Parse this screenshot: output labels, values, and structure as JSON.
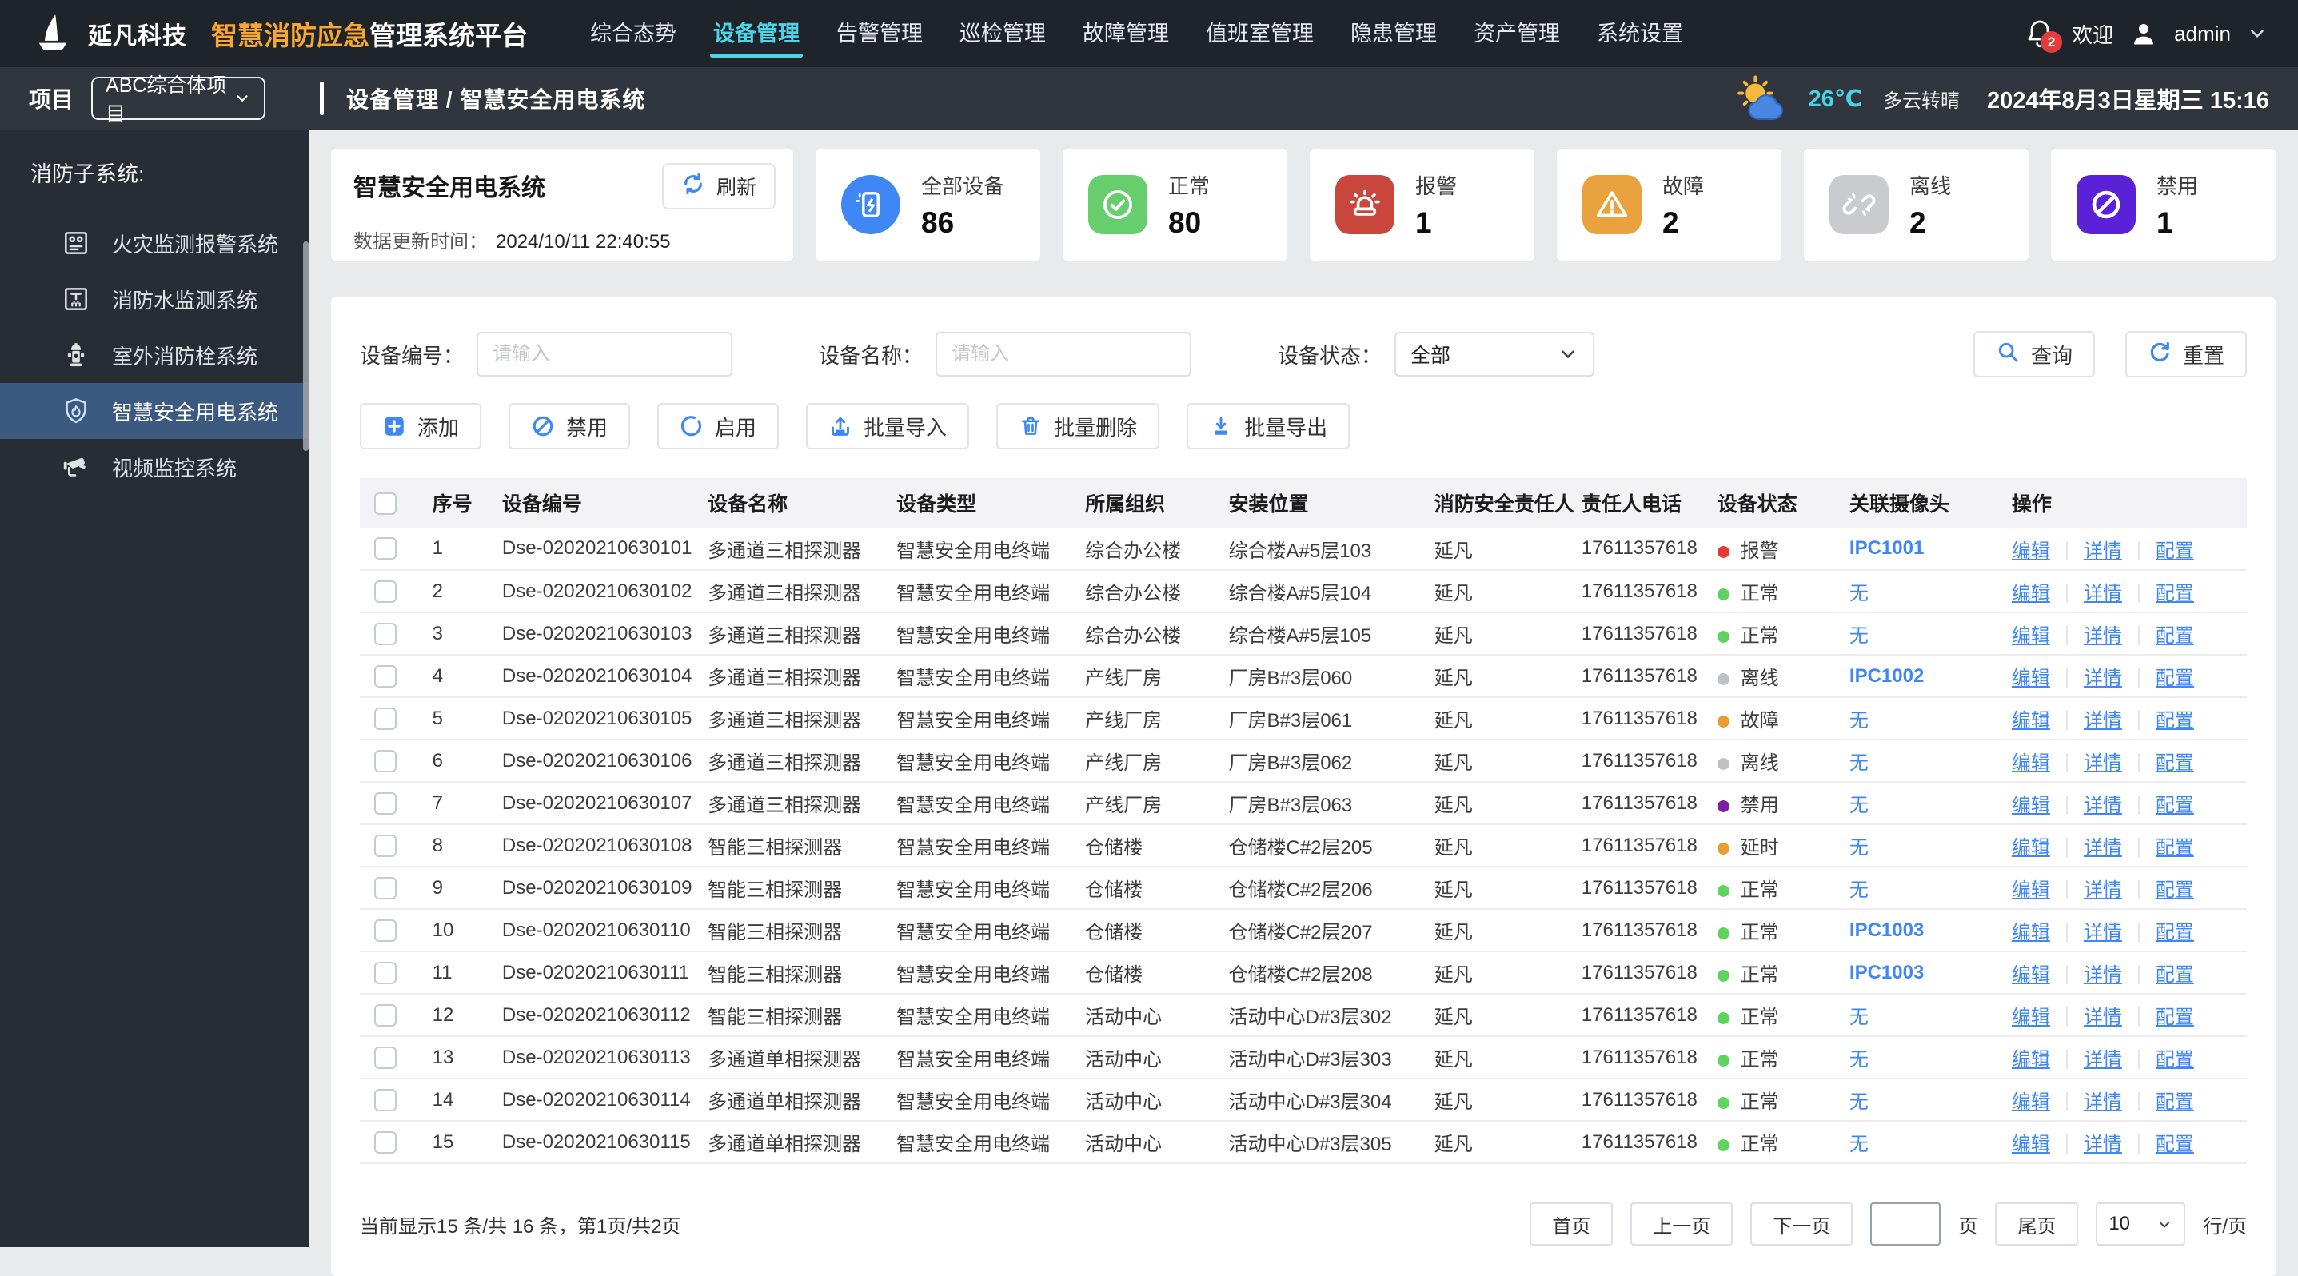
{
  "topbar": {
    "brand": {
      "company": "延凡科技",
      "highlight": "智慧消防应急",
      "suffix": "管理系统平台"
    },
    "nav": [
      {
        "label": "综合态势",
        "active": false
      },
      {
        "label": "设备管理",
        "active": true
      },
      {
        "label": "告警管理",
        "active": false
      },
      {
        "label": "巡检管理",
        "active": false
      },
      {
        "label": "故障管理",
        "active": false
      },
      {
        "label": "值班室管理",
        "active": false
      },
      {
        "label": "隐患管理",
        "active": false
      },
      {
        "label": "资产管理",
        "active": false
      },
      {
        "label": "系统设置",
        "active": false
      }
    ],
    "notification_count": "2",
    "welcome": "欢迎",
    "username": "admin",
    "active_color": "#4ed4e6"
  },
  "subheader": {
    "project_label": "项目",
    "project_value": "ABC综合体项目",
    "breadcrumb": "设备管理 / 智慧安全用电系统",
    "weather_temp": "26℃",
    "weather_condition": "多云转晴",
    "datetime": "2024年8月3日星期三 15:16"
  },
  "sidebar": {
    "group_label": "消防子系统:",
    "items": [
      {
        "label": "火灾监测报警系统",
        "icon": "fire-alarm-panel-icon",
        "active": false
      },
      {
        "label": "消防水监测系统",
        "icon": "water-monitor-icon",
        "active": false
      },
      {
        "label": "室外消防栓系统",
        "icon": "hydrant-icon",
        "active": false
      },
      {
        "label": "智慧安全用电系统",
        "icon": "shield-flame-icon",
        "active": true
      },
      {
        "label": "视频监控系统",
        "icon": "camera-icon",
        "active": false
      }
    ]
  },
  "overview": {
    "title": "智慧安全用电系统",
    "refresh_label": "刷新",
    "updated_label": "数据更新时间：",
    "updated_value": "2024/10/11 22:40:55",
    "stats": [
      {
        "label": "全部设备",
        "value": "86",
        "icon": "device-icon",
        "bg": "#3f87f5",
        "shape": "circle"
      },
      {
        "label": "正常",
        "value": "80",
        "icon": "check-icon",
        "bg": "#67ce6e",
        "shape": "square"
      },
      {
        "label": "报警",
        "value": "1",
        "icon": "alarm-icon",
        "bg": "#c9463d",
        "shape": "square"
      },
      {
        "label": "故障",
        "value": "2",
        "icon": "fault-icon",
        "bg": "#eaa23e",
        "shape": "square"
      },
      {
        "label": "离线",
        "value": "2",
        "icon": "offline-icon",
        "bg": "#c9cbce",
        "shape": "square"
      },
      {
        "label": "禁用",
        "value": "1",
        "icon": "ban-icon",
        "bg": "#5b21d6",
        "shape": "square"
      }
    ]
  },
  "filters": {
    "device_no_label": "设备编号：",
    "device_no_placeholder": "请输入",
    "device_name_label": "设备名称：",
    "device_name_placeholder": "请输入",
    "status_label": "设备状态：",
    "status_value": "全部",
    "search_label": "查询",
    "reset_label": "重置"
  },
  "actions": [
    {
      "label": "添加",
      "icon": "plus-square-icon"
    },
    {
      "label": "禁用",
      "icon": "ban-circle-icon"
    },
    {
      "label": "启用",
      "icon": "enable-circle-icon"
    },
    {
      "label": "批量导入",
      "icon": "import-icon"
    },
    {
      "label": "批量删除",
      "icon": "trash-icon"
    },
    {
      "label": "批量导出",
      "icon": "export-icon"
    }
  ],
  "table": {
    "columns": [
      "",
      "序号",
      "设备编号",
      "设备名称",
      "设备类型",
      "所属组织",
      "安装位置",
      "消防安全责任人",
      "责任人电话",
      "设备状态",
      "关联摄像头",
      "操作"
    ],
    "ops": [
      "编辑",
      "详情",
      "配置"
    ],
    "status_colors": {
      "报警": "#e53935",
      "正常": "#5ed45e",
      "离线": "#bfc1c4",
      "故障": "#eb9c32",
      "禁用": "#7b1fa2",
      "延时": "#eb9c32"
    },
    "link_color": "#3f87f5",
    "rows": [
      {
        "no": "1",
        "code": "Dse-02020210630101",
        "name": "多通道三相探测器",
        "type": "智慧安全用电终端",
        "org": "综合办公楼",
        "location": "综合楼A#5层103",
        "person": "延凡",
        "phone": "17611357618",
        "status": "报警",
        "camera": "IPC1001"
      },
      {
        "no": "2",
        "code": "Dse-02020210630102",
        "name": "多通道三相探测器",
        "type": "智慧安全用电终端",
        "org": "综合办公楼",
        "location": "综合楼A#5层104",
        "person": "延凡",
        "phone": "17611357618",
        "status": "正常",
        "camera": "无"
      },
      {
        "no": "3",
        "code": "Dse-02020210630103",
        "name": "多通道三相探测器",
        "type": "智慧安全用电终端",
        "org": "综合办公楼",
        "location": "综合楼A#5层105",
        "person": "延凡",
        "phone": "17611357618",
        "status": "正常",
        "camera": "无"
      },
      {
        "no": "4",
        "code": "Dse-02020210630104",
        "name": "多通道三相探测器",
        "type": "智慧安全用电终端",
        "org": "产线厂房",
        "location": "厂房B#3层060",
        "person": "延凡",
        "phone": "17611357618",
        "status": "离线",
        "camera": "IPC1002"
      },
      {
        "no": "5",
        "code": "Dse-02020210630105",
        "name": "多通道三相探测器",
        "type": "智慧安全用电终端",
        "org": "产线厂房",
        "location": "厂房B#3层061",
        "person": "延凡",
        "phone": "17611357618",
        "status": "故障",
        "camera": "无"
      },
      {
        "no": "6",
        "code": "Dse-02020210630106",
        "name": "多通道三相探测器",
        "type": "智慧安全用电终端",
        "org": "产线厂房",
        "location": "厂房B#3层062",
        "person": "延凡",
        "phone": "17611357618",
        "status": "离线",
        "camera": "无"
      },
      {
        "no": "7",
        "code": "Dse-02020210630107",
        "name": "多通道三相探测器",
        "type": "智慧安全用电终端",
        "org": "产线厂房",
        "location": "厂房B#3层063",
        "person": "延凡",
        "phone": "17611357618",
        "status": "禁用",
        "camera": "无"
      },
      {
        "no": "8",
        "code": "Dse-02020210630108",
        "name": "智能三相探测器",
        "type": "智慧安全用电终端",
        "org": "仓储楼",
        "location": "仓储楼C#2层205",
        "person": "延凡",
        "phone": "17611357618",
        "status": "延时",
        "camera": "无"
      },
      {
        "no": "9",
        "code": "Dse-02020210630109",
        "name": "智能三相探测器",
        "type": "智慧安全用电终端",
        "org": "仓储楼",
        "location": "仓储楼C#2层206",
        "person": "延凡",
        "phone": "17611357618",
        "status": "正常",
        "camera": "无"
      },
      {
        "no": "10",
        "code": "Dse-02020210630110",
        "name": "智能三相探测器",
        "type": "智慧安全用电终端",
        "org": "仓储楼",
        "location": "仓储楼C#2层207",
        "person": "延凡",
        "phone": "17611357618",
        "status": "正常",
        "camera": "IPC1003"
      },
      {
        "no": "11",
        "code": "Dse-02020210630111",
        "name": "智能三相探测器",
        "type": "智慧安全用电终端",
        "org": "仓储楼",
        "location": "仓储楼C#2层208",
        "person": "延凡",
        "phone": "17611357618",
        "status": "正常",
        "camera": "IPC1003"
      },
      {
        "no": "12",
        "code": "Dse-02020210630112",
        "name": "智能三相探测器",
        "type": "智慧安全用电终端",
        "org": "活动中心",
        "location": "活动中心D#3层302",
        "person": "延凡",
        "phone": "17611357618",
        "status": "正常",
        "camera": "无"
      },
      {
        "no": "13",
        "code": "Dse-02020210630113",
        "name": "多通道单相探测器",
        "type": "智慧安全用电终端",
        "org": "活动中心",
        "location": "活动中心D#3层303",
        "person": "延凡",
        "phone": "17611357618",
        "status": "正常",
        "camera": "无"
      },
      {
        "no": "14",
        "code": "Dse-02020210630114",
        "name": "多通道单相探测器",
        "type": "智慧安全用电终端",
        "org": "活动中心",
        "location": "活动中心D#3层304",
        "person": "延凡",
        "phone": "17611357618",
        "status": "正常",
        "camera": "无"
      },
      {
        "no": "15",
        "code": "Dse-02020210630115",
        "name": "多通道单相探测器",
        "type": "智慧安全用电终端",
        "org": "活动中心",
        "location": "活动中心D#3层305",
        "person": "延凡",
        "phone": "17611357618",
        "status": "正常",
        "camera": "无"
      }
    ]
  },
  "pagination": {
    "summary": "当前显示15 条/共 16 条，第1页/共2页",
    "first_label": "首页",
    "prev_label": "上一页",
    "next_label": "下一页",
    "page_input_value": "",
    "page_suffix": "页",
    "last_label": "尾页",
    "page_size": "10",
    "rows_per_page_suffix": "行/页"
  }
}
